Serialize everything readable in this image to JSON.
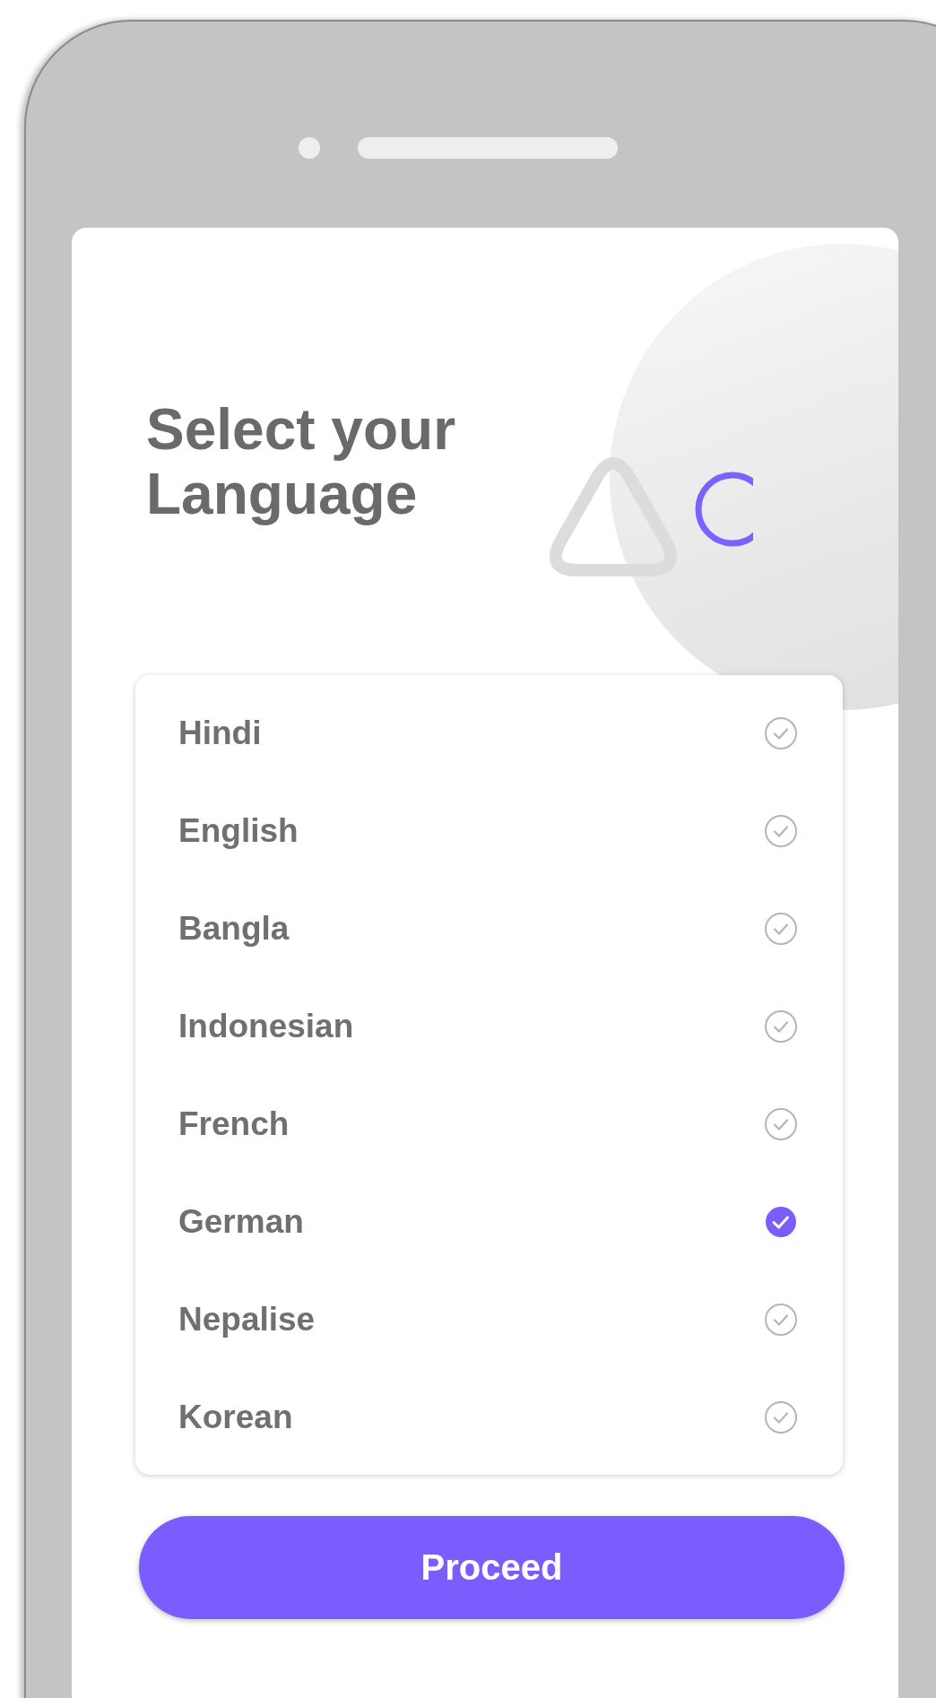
{
  "title": "Select your Language",
  "languages": [
    {
      "label": "Hindi",
      "selected": false
    },
    {
      "label": "English",
      "selected": false
    },
    {
      "label": "Bangla",
      "selected": false
    },
    {
      "label": "Indonesian",
      "selected": false
    },
    {
      "label": "French",
      "selected": false
    },
    {
      "label": "German",
      "selected": true
    },
    {
      "label": "Nepalise",
      "selected": false
    },
    {
      "label": "Korean",
      "selected": false
    }
  ],
  "button": "Proceed"
}
